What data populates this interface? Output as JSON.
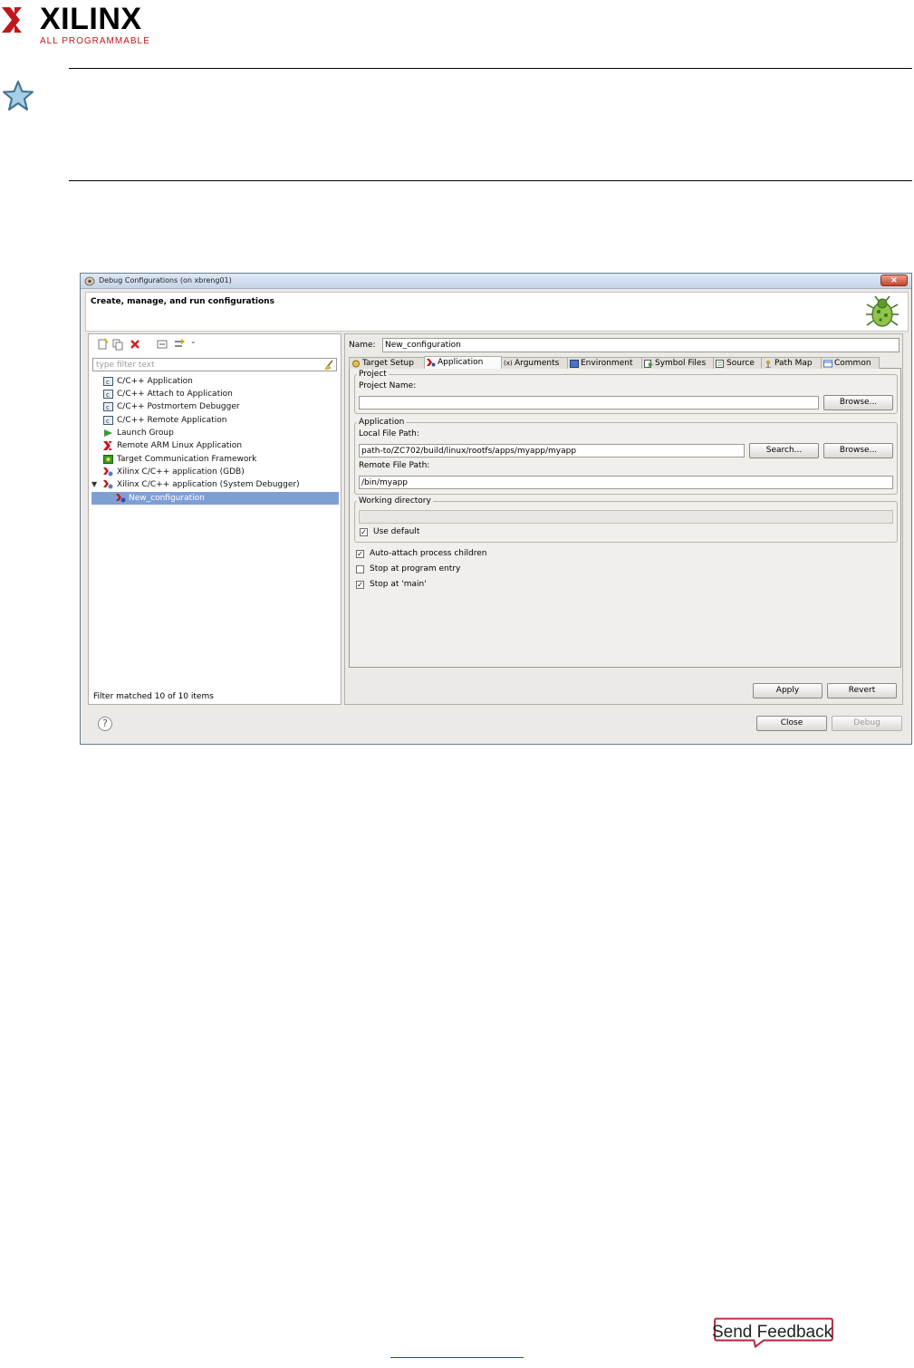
{
  "brand": {
    "name": "XILINX",
    "tagline": "ALL PROGRAMMABLE",
    "logo_icon": "xilinx-logo-icon"
  },
  "note": {
    "icon": "star-icon"
  },
  "dialog": {
    "title": "Debug Configurations  (on xbreng01)",
    "banner_title": "Create, manage, and run configurations",
    "banner_icon": "bug-icon",
    "filter_placeholder": "type filter text",
    "tree": [
      {
        "label": "C/C++ Application",
        "icon": "c-app-icon"
      },
      {
        "label": "C/C++ Attach to Application",
        "icon": "c-app-icon"
      },
      {
        "label": "C/C++ Postmortem Debugger",
        "icon": "c-app-icon"
      },
      {
        "label": "C/C++ Remote Application",
        "icon": "c-app-icon"
      },
      {
        "label": "Launch Group",
        "icon": "launch-group-icon"
      },
      {
        "label": "Remote ARM Linux Application",
        "icon": "xilinx-icon"
      },
      {
        "label": "Target Communication Framework",
        "icon": "tcf-icon"
      },
      {
        "label": "Xilinx C/C++ application (GDB)",
        "icon": "xilinx-gdb-icon"
      },
      {
        "label": "Xilinx C/C++ application (System Debugger)",
        "icon": "xilinx-gdb-icon"
      },
      {
        "label": "New_configuration",
        "icon": "config-icon"
      }
    ],
    "filter_status": "Filter matched 10 of 10 items",
    "name_label": "Name:",
    "name_value": "New_configuration",
    "tabs": [
      "Target Setup",
      "Application",
      "Arguments",
      "Environment",
      "Symbol Files",
      "Source",
      "Path Map",
      "Common"
    ],
    "active_tab": "Application",
    "project_group": "Project",
    "project_name_label": "Project Name:",
    "project_name_value": "",
    "browse_label": "Browse...",
    "application_group": "Application",
    "local_path_label": "Local File Path:",
    "local_path_value": "path-to/ZC702/build/linux/rootfs/apps/myapp/myapp",
    "search_label": "Search...",
    "remote_path_label": "Remote File Path:",
    "remote_path_value": "/bin/myapp",
    "working_dir_group": "Working directory",
    "use_default_label": "Use default",
    "use_default_checked": true,
    "auto_attach_label": "Auto-attach process children",
    "auto_attach_checked": true,
    "stop_entry_label": "Stop at program entry",
    "stop_entry_checked": false,
    "stop_main_label": "Stop at 'main'",
    "stop_main_checked": true,
    "apply_label": "Apply",
    "revert_label": "Revert",
    "close_label": "Close",
    "debug_label": "Debug",
    "help_label": "?"
  },
  "footer": {
    "send_feedback": "Send Feedback"
  }
}
